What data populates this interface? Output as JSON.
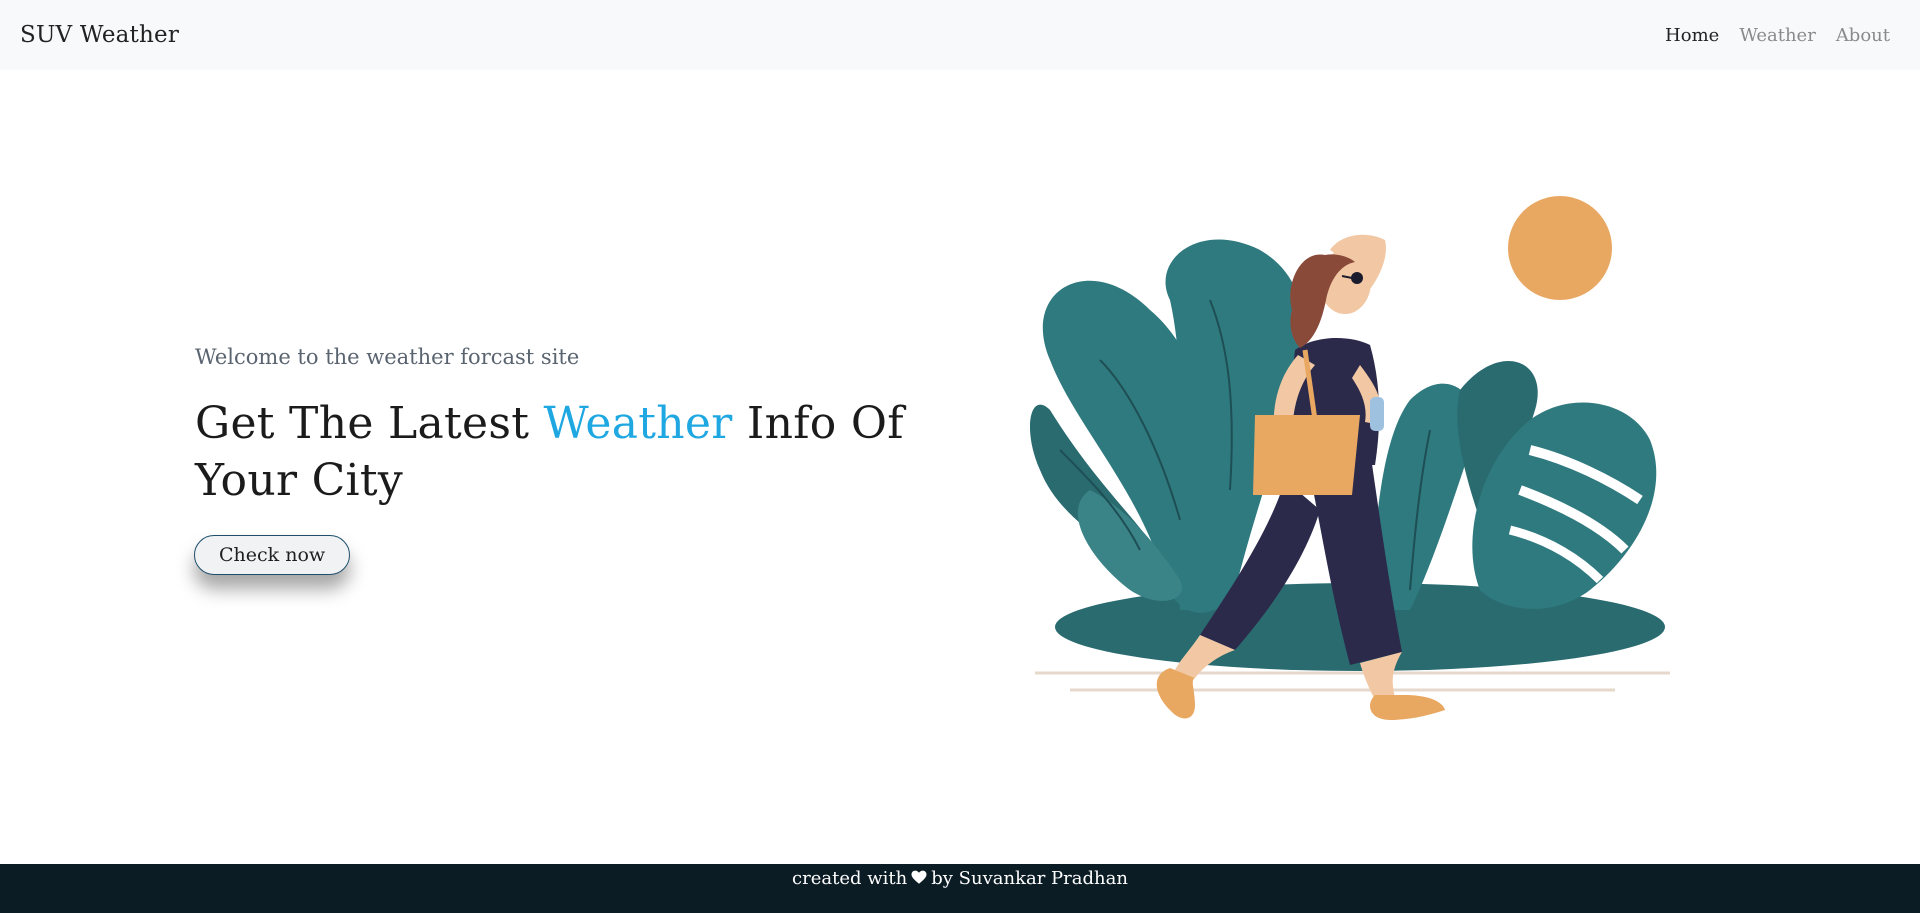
{
  "navbar": {
    "brand": "SUV Weather",
    "links": [
      {
        "label": "Home",
        "active": true
      },
      {
        "label": "Weather",
        "active": false
      },
      {
        "label": "About",
        "active": false
      }
    ]
  },
  "hero": {
    "welcome": "Welcome to the weather forcast site",
    "headline_part1": "Get The Latest ",
    "headline_accent": "Weather",
    "headline_part2": " Info Of Your City",
    "cta_label": "Check now",
    "illustration_icon": "woman-walking-with-plants-and-sun-illustration"
  },
  "footer": {
    "prefix": "created with",
    "heart_icon": "heart-icon",
    "suffix": "by Suvankar Pradhan"
  },
  "colors": {
    "accent": "#1ea7e1",
    "footer_bg": "#0c1c25",
    "navbar_bg": "#f8f9fa",
    "sun": "#e9a862",
    "leaf": "#2f7a7f",
    "leaf_dark": "#25656a",
    "outfit": "#2c2a4a"
  }
}
